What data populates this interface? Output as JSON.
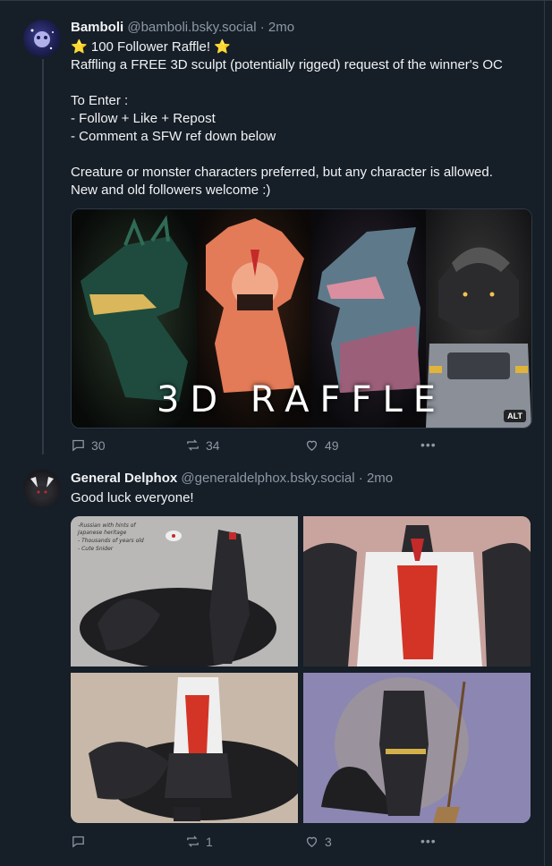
{
  "posts": [
    {
      "author": "Bamboli",
      "handle": "@bamboli.bsky.social",
      "separator": "·",
      "time": "2mo",
      "lines": [
        "100 Follower Raffle!",
        "Raffling a FREE 3D sculpt (potentially rigged) request of the winner's OC",
        "",
        "To Enter :",
        "- Follow + Like + Repost",
        "- Comment a SFW ref down below",
        "",
        "Creature or monster characters preferred, but any character is allowed.",
        "New and old followers welcome :)"
      ],
      "star_glyph": "⭐",
      "image_text": "3D RAFFLE",
      "alt_badge": "ALT",
      "replies": "30",
      "reposts": "34",
      "likes": "49",
      "more": "•••"
    },
    {
      "author": "General Delphox",
      "handle": "@generaldelphox.bsky.social",
      "separator": "·",
      "time": "2mo",
      "text": "Good luck everyone!",
      "sketch_note": "-Russian with hints of\nJapanese heritage\n- Thousands of years old\n- Cute Snider",
      "replies": "",
      "reposts": "1",
      "likes": "3",
      "more": "•••"
    }
  ],
  "colors": {
    "background": "#161e27",
    "muted": "#8b98a5",
    "divider": "#2e3a47",
    "star": "#f6c53b"
  }
}
